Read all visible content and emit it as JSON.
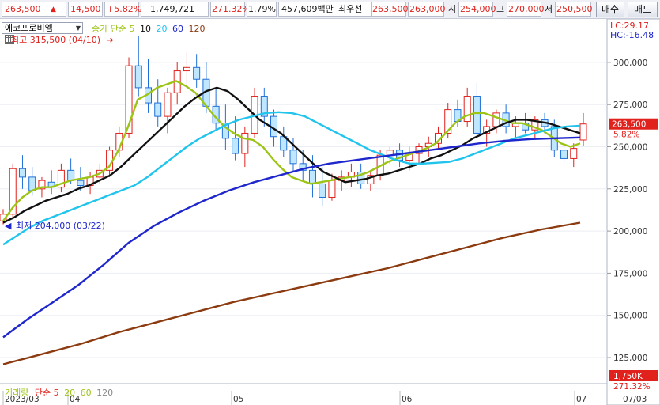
{
  "ticker": {
    "price": "263,500",
    "change": "14,500",
    "change_pct": "+5.82%",
    "volume": "1,749,721",
    "volume_ratio": "271.32%",
    "turnover_pct": "1.79%",
    "trade_value": "457,609백만",
    "best_bid_label": "최우선",
    "ask": "263,500",
    "bid": "263,000",
    "open_label": "시",
    "open": "254,000",
    "high_label": "고",
    "high": "270,000",
    "low_label": "저",
    "low": "250,500",
    "buy_label": "매수",
    "sell_label": "매도"
  },
  "legend": {
    "stock_name": "에코프로비엠",
    "price_label": "종가 단순 5",
    "ma_periods": [
      "10",
      "20",
      "60",
      "120"
    ],
    "ma_colors": [
      "#9cc414",
      "#111111",
      "#20c4ec",
      "#1f27cc",
      "#8c3b10"
    ],
    "volume_label": "거래량",
    "volume_type": "단순 5",
    "volume_periods": [
      "20",
      "60",
      "120"
    ]
  },
  "annotations": {
    "high": "최고 315,500 (04/10)",
    "low": "최저 204,000 (03/22)",
    "lc": "LC:29.17",
    "hc": "HC:-16.48",
    "current_price_tag": "263,500",
    "current_pct_tag": "5.82%",
    "volume_tag": "1,750K",
    "volume_pct_tag": "271.32%"
  },
  "chart_data": {
    "type": "candlestick",
    "y_ticks": [
      "300,000",
      "275,000",
      "250,000",
      "225,000",
      "200,000",
      "175,000",
      "150,000",
      "125,000"
    ],
    "ylim": [
      110000,
      322000
    ],
    "x_labels": [
      "2023/03",
      "04",
      "05",
      "06",
      "07"
    ],
    "x_right_label": "07/03",
    "candles": [
      [
        206000,
        213000,
        204000,
        210000
      ],
      [
        210000,
        240000,
        208000,
        237000
      ],
      [
        237000,
        245000,
        225000,
        232000
      ],
      [
        232000,
        238000,
        221000,
        224000
      ],
      [
        225000,
        232000,
        220000,
        230000
      ],
      [
        229000,
        236000,
        222000,
        226000
      ],
      [
        226000,
        240000,
        223000,
        236000
      ],
      [
        236000,
        243000,
        228000,
        230000
      ],
      [
        230000,
        238000,
        224000,
        227000
      ],
      [
        227000,
        235000,
        222000,
        232000
      ],
      [
        232000,
        240000,
        228000,
        236000
      ],
      [
        236000,
        250000,
        232000,
        248000
      ],
      [
        248000,
        262000,
        244000,
        258000
      ],
      [
        258000,
        303000,
        255000,
        298000
      ],
      [
        298000,
        315500,
        280000,
        285000
      ],
      [
        285000,
        302000,
        270000,
        276000
      ],
      [
        276000,
        290000,
        262000,
        268000
      ],
      [
        268000,
        285000,
        258000,
        282000
      ],
      [
        282000,
        300000,
        275000,
        295000
      ],
      [
        295000,
        306000,
        285000,
        297000
      ],
      [
        297000,
        305000,
        285000,
        290000
      ],
      [
        290000,
        300000,
        270000,
        274000
      ],
      [
        274000,
        285000,
        260000,
        264000
      ],
      [
        264000,
        275000,
        248000,
        255000
      ],
      [
        255000,
        268000,
        242000,
        246000
      ],
      [
        246000,
        262000,
        238000,
        258000
      ],
      [
        258000,
        285000,
        255000,
        280000
      ],
      [
        280000,
        285000,
        262000,
        268000
      ],
      [
        268000,
        272000,
        250000,
        256000
      ],
      [
        256000,
        262000,
        244000,
        248000
      ],
      [
        248000,
        255000,
        235000,
        240000
      ],
      [
        240000,
        248000,
        230000,
        236000
      ],
      [
        236000,
        245000,
        220000,
        228000
      ],
      [
        228000,
        238000,
        215000,
        220000
      ],
      [
        220000,
        234000,
        218000,
        230000
      ],
      [
        230000,
        236000,
        224000,
        232000
      ],
      [
        232000,
        240000,
        226000,
        235000
      ],
      [
        235000,
        240000,
        225000,
        228000
      ],
      [
        228000,
        236000,
        224000,
        233000
      ],
      [
        233000,
        248000,
        230000,
        245000
      ],
      [
        245000,
        250000,
        240000,
        248000
      ],
      [
        248000,
        252000,
        238000,
        242000
      ],
      [
        242000,
        250000,
        236000,
        246000
      ],
      [
        246000,
        252000,
        240000,
        250000
      ],
      [
        250000,
        256000,
        244000,
        252000
      ],
      [
        252000,
        262000,
        248000,
        258000
      ],
      [
        258000,
        276000,
        255000,
        272000
      ],
      [
        272000,
        278000,
        262000,
        265000
      ],
      [
        265000,
        285000,
        262000,
        280000
      ],
      [
        280000,
        288000,
        255000,
        258000
      ],
      [
        258000,
        266000,
        250000,
        262000
      ],
      [
        262000,
        272000,
        258000,
        270000
      ],
      [
        270000,
        275000,
        258000,
        262000
      ],
      [
        262000,
        268000,
        255000,
        264000
      ],
      [
        264000,
        270000,
        258000,
        260000
      ],
      [
        260000,
        268000,
        255000,
        266000
      ],
      [
        266000,
        270000,
        258000,
        262000
      ],
      [
        262000,
        266000,
        244000,
        248000
      ],
      [
        248000,
        252000,
        240000,
        243000
      ],
      [
        243000,
        252000,
        238000,
        249000
      ],
      [
        254000,
        270000,
        250500,
        263500
      ]
    ],
    "ma_series": [
      {
        "name": "5",
        "color": "#9cc414",
        "values": [
          206000,
          214000,
          220000,
          224000,
          226000,
          226000,
          228000,
          230000,
          231000,
          232000,
          234000,
          238000,
          248000,
          262000,
          278000,
          281000,
          285000,
          287000,
          289000,
          286000,
          282000,
          275000,
          268000,
          262000,
          258000,
          255000,
          254000,
          250000,
          243000,
          237000,
          232000,
          230000,
          228000,
          229000,
          230000,
          231000,
          232000,
          233000,
          235000,
          238000,
          241000,
          243000,
          245000,
          247000,
          249000,
          252000,
          258000,
          264000,
          268000,
          270000,
          270000,
          268000,
          266000,
          264000,
          264000,
          262000,
          260000,
          256000,
          252000,
          250000,
          252000
        ]
      },
      {
        "name": "10",
        "color": "#111111",
        "values": [
          205000,
          208000,
          212000,
          215000,
          218000,
          220000,
          222000,
          225000,
          227000,
          230000,
          233000,
          238000,
          244000,
          250000,
          256000,
          262000,
          268000,
          274000,
          279000,
          283000,
          285000,
          283000,
          278000,
          272000,
          266000,
          262000,
          258000,
          252000,
          246000,
          240000,
          235000,
          232000,
          229000,
          230000,
          231000,
          233000,
          234000,
          236000,
          238000,
          240000,
          243000,
          245000,
          248000,
          251000,
          255000,
          258000,
          261000,
          264000,
          266000,
          266000,
          265000,
          264000,
          262000,
          260000,
          258000
        ]
      },
      {
        "name": "20",
        "color": "#20c4ec",
        "values": [
          192000,
          197000,
          202000,
          206000,
          209000,
          212000,
          215000,
          218000,
          221000,
          224000,
          227000,
          232000,
          238000,
          244000,
          250000,
          255000,
          259000,
          263000,
          266000,
          268000,
          270000,
          270500,
          270000,
          268000,
          264000,
          260000,
          256000,
          252000,
          248000,
          245000,
          242000,
          240000,
          240000,
          240500,
          241000,
          243000,
          246000,
          249000,
          252000,
          255000,
          257000,
          259000,
          261000,
          262000,
          262500
        ]
      },
      {
        "name": "60",
        "color": "#1f27cc",
        "values": [
          137000,
          148000,
          158000,
          168000,
          180000,
          193000,
          203000,
          211000,
          218000,
          224000,
          229000,
          233000,
          237000,
          240000,
          242000,
          244000,
          246000,
          248000,
          250000,
          252000,
          253500,
          254500,
          255000,
          255500
        ]
      },
      {
        "name": "120",
        "color": "#8c3b10",
        "values": [
          121000,
          127000,
          133000,
          140000,
          146000,
          152000,
          158000,
          163000,
          168000,
          173000,
          178000,
          184000,
          190000,
          196000,
          201000,
          205000
        ]
      }
    ]
  }
}
